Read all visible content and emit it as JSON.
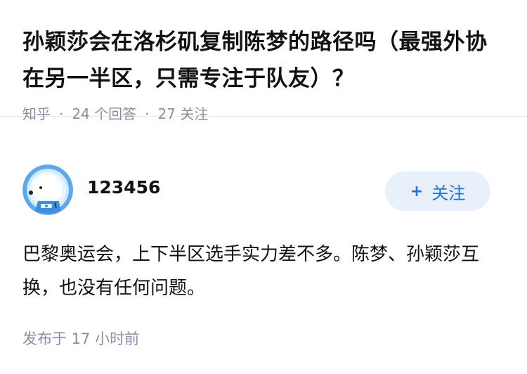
{
  "question": {
    "title": "孙颖莎会在洛杉矶复制陈梦的路径吗（最强外协在另一半区，只需专注于队友）？",
    "source": "知乎",
    "separator": "·",
    "answer_count": "24 个回答",
    "follower_count": "27 关注"
  },
  "answer": {
    "author_name": "123456",
    "avatar_icon": "polar-bear-astronaut-avatar",
    "follow_plus": "+",
    "follow_label": "关注",
    "content": "巴黎奥运会，上下半区选手实力差不多。陈梦、孙颖莎互换，也没有任何问题。",
    "publish_time": "发布于 17 小时前"
  },
  "colors": {
    "accent": "#1772f6",
    "accent_bg": "#e8f0fb",
    "meta_text": "#8590a6",
    "avatar_ring": "#5aa9f0"
  }
}
